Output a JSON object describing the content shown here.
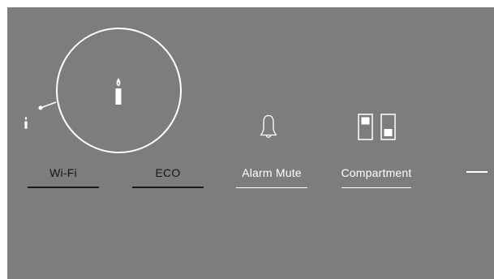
{
  "modes": [
    {
      "id": "wifi",
      "label": "Wi-Fi",
      "state": "inactive"
    },
    {
      "id": "eco",
      "label": "ECO",
      "state": "inactive"
    },
    {
      "id": "alarm-mute",
      "label": "Alarm Mute",
      "state": "active"
    },
    {
      "id": "compartment",
      "label": "Compartment",
      "state": "active"
    }
  ],
  "icons": {
    "center": "candle-icon",
    "small": "candle-small-icon",
    "alarm": "bell-icon",
    "compartment": "compartment-icon",
    "more": "dash-icon"
  },
  "colors": {
    "background": "#7d7e7c",
    "active": "#ffffff",
    "inactive": "#1a1a1a"
  }
}
